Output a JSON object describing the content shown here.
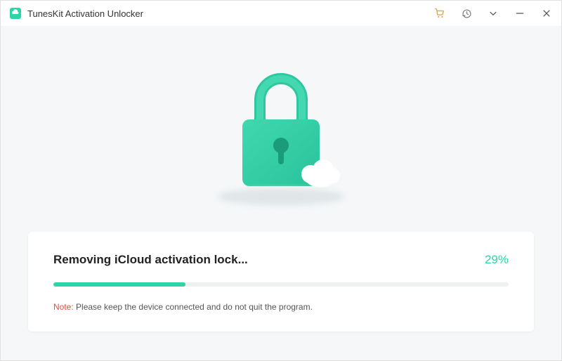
{
  "app": {
    "title": "TunesKit Activation Unlocker"
  },
  "progress": {
    "status": "Removing iCloud activation lock...",
    "percent": 29,
    "percent_display": "29%",
    "note_label": "Note:",
    "note_text": " Please keep the device connected and do not quit the program."
  },
  "colors": {
    "accent": "#2dd4a8",
    "warning": "#e74c3c"
  },
  "icons": {
    "logo": "cloud-logo",
    "cart": "cart-icon",
    "history": "history-icon",
    "dropdown": "chevron-down-icon",
    "minimize": "minimize-icon",
    "close": "close-icon"
  }
}
